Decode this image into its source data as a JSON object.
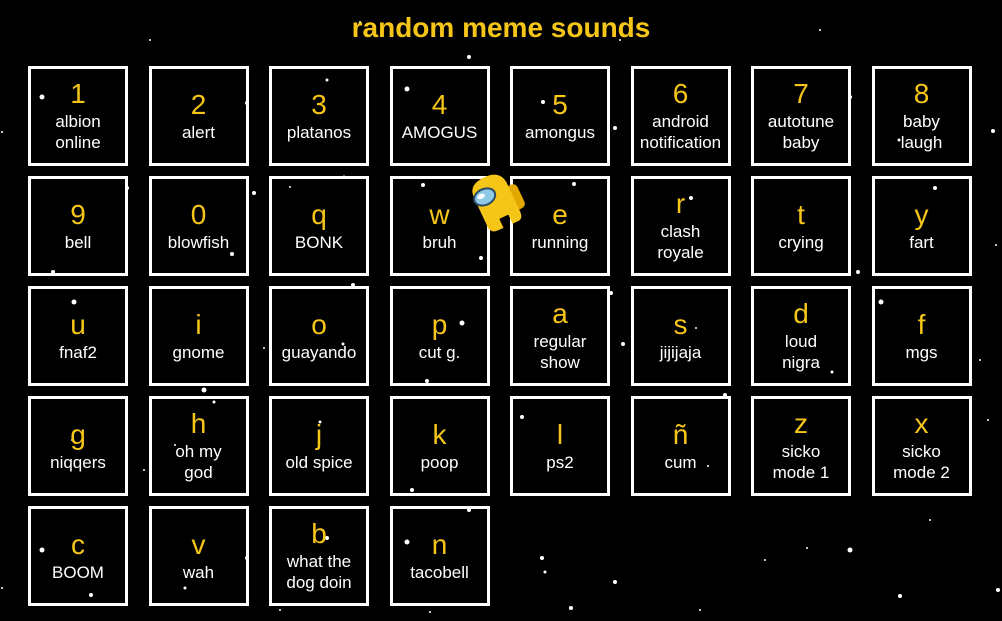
{
  "title": "random meme sounds",
  "colors": {
    "background": "#000000",
    "accent": "#f5c518",
    "border": "#ffffff",
    "label": "#ffffff"
  },
  "pads": [
    {
      "key": "1",
      "label": "albion\nonline"
    },
    {
      "key": "2",
      "label": "alert"
    },
    {
      "key": "3",
      "label": "platanos"
    },
    {
      "key": "4",
      "label": "AMOGUS"
    },
    {
      "key": "5",
      "label": "amongus"
    },
    {
      "key": "6",
      "label": "android\nnotification"
    },
    {
      "key": "7",
      "label": "autotune\nbaby"
    },
    {
      "key": "8",
      "label": "baby\nlaugh"
    },
    {
      "key": "9",
      "label": "bell"
    },
    {
      "key": "0",
      "label": "blowfish"
    },
    {
      "key": "q",
      "label": "BONK"
    },
    {
      "key": "w",
      "label": "bruh"
    },
    {
      "key": "e",
      "label": "running"
    },
    {
      "key": "r",
      "label": "clash\nroyale"
    },
    {
      "key": "t",
      "label": "crying"
    },
    {
      "key": "y",
      "label": "fart"
    },
    {
      "key": "u",
      "label": "fnaf2"
    },
    {
      "key": "i",
      "label": "gnome"
    },
    {
      "key": "o",
      "label": "guayando"
    },
    {
      "key": "p",
      "label": "cut g."
    },
    {
      "key": "a",
      "label": "regular\nshow"
    },
    {
      "key": "s",
      "label": "jijijaja"
    },
    {
      "key": "d",
      "label": "loud\nnigra"
    },
    {
      "key": "f",
      "label": "mgs"
    },
    {
      "key": "g",
      "label": "niqqers"
    },
    {
      "key": "h",
      "label": "oh my\ngod"
    },
    {
      "key": "j",
      "label": "old spice"
    },
    {
      "key": "k",
      "label": "poop"
    },
    {
      "key": "l",
      "label": "ps2"
    },
    {
      "key": "ñ",
      "label": "cum"
    },
    {
      "key": "z",
      "label": "sicko\nmode 1"
    },
    {
      "key": "x",
      "label": "sicko\nmode 2"
    },
    {
      "key": "c",
      "label": "BOOM"
    },
    {
      "key": "v",
      "label": "wah"
    },
    {
      "key": "b",
      "label": "what the\ndog doin"
    },
    {
      "key": "n",
      "label": "tacobell"
    }
  ],
  "decorations": {
    "character_icon": "amogus-crewmate-icon",
    "background_icon": "starfield"
  }
}
